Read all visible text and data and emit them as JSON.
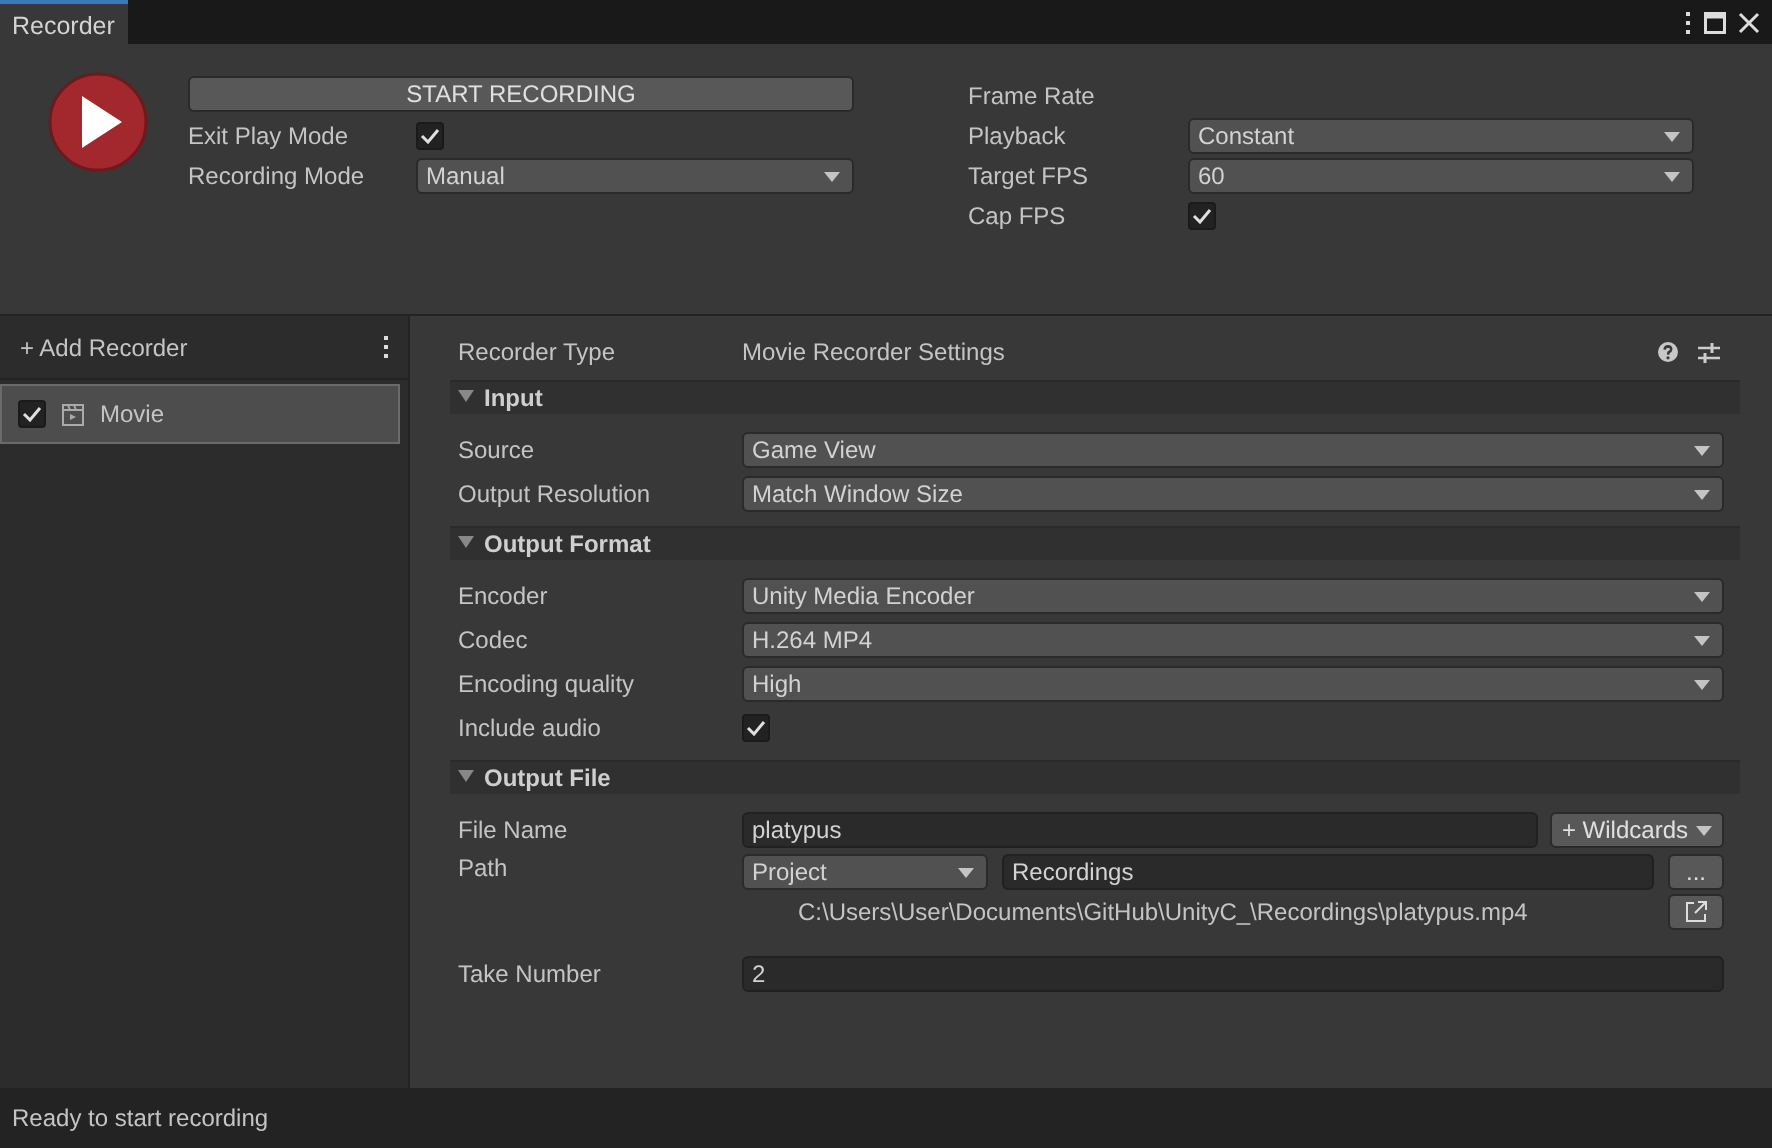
{
  "window": {
    "tab": {
      "label": "Recorder",
      "selected": true
    }
  },
  "controls": {
    "start_button": "START RECORDING",
    "exit_play_mode": {
      "label": "Exit Play Mode",
      "checked": true
    },
    "recording_mode": {
      "label": "Recording Mode",
      "value": "Manual"
    }
  },
  "frame_rate": {
    "title": "Frame Rate",
    "playback": {
      "label": "Playback",
      "value": "Constant"
    },
    "target_fps": {
      "label": "Target FPS",
      "value": "60"
    },
    "cap_fps": {
      "label": "Cap FPS",
      "checked": true
    }
  },
  "sidebar": {
    "add_button": "+ Add Recorder",
    "items": [
      {
        "name": "Movie",
        "enabled": true,
        "selected": true
      }
    ]
  },
  "inspector": {
    "recorder_type": {
      "label": "Recorder Type",
      "value": "Movie Recorder Settings"
    },
    "sections": [
      {
        "title": "Input",
        "expanded": true,
        "fields": [
          {
            "kind": "dropdown",
            "label": "Source",
            "value": "Game View"
          },
          {
            "kind": "dropdown",
            "label": "Output Resolution",
            "value": "Match Window Size"
          }
        ]
      },
      {
        "title": "Output Format",
        "expanded": true,
        "fields": [
          {
            "kind": "dropdown",
            "label": "Encoder",
            "value": "Unity Media Encoder"
          },
          {
            "kind": "dropdown",
            "label": "Codec",
            "value": "H.264 MP4"
          },
          {
            "kind": "dropdown",
            "label": "Encoding quality",
            "value": "High"
          },
          {
            "kind": "checkbox",
            "label": "Include audio",
            "checked": true
          }
        ]
      },
      {
        "title": "Output File",
        "expanded": true,
        "fields": [
          {
            "kind": "text_button",
            "label": "File Name",
            "value": "platypus",
            "button": "+ Wildcards"
          },
          {
            "kind": "path",
            "label": "Path",
            "location": "Project",
            "value": "Recordings",
            "button": "...",
            "resolved": "C:\\Users\\User\\Documents\\GitHub\\UnityC_\\Recordings\\platypus.mp4"
          },
          {
            "kind": "text",
            "label": "Take Number",
            "value": "2"
          }
        ]
      }
    ]
  },
  "status_bar": "Ready to start recording"
}
